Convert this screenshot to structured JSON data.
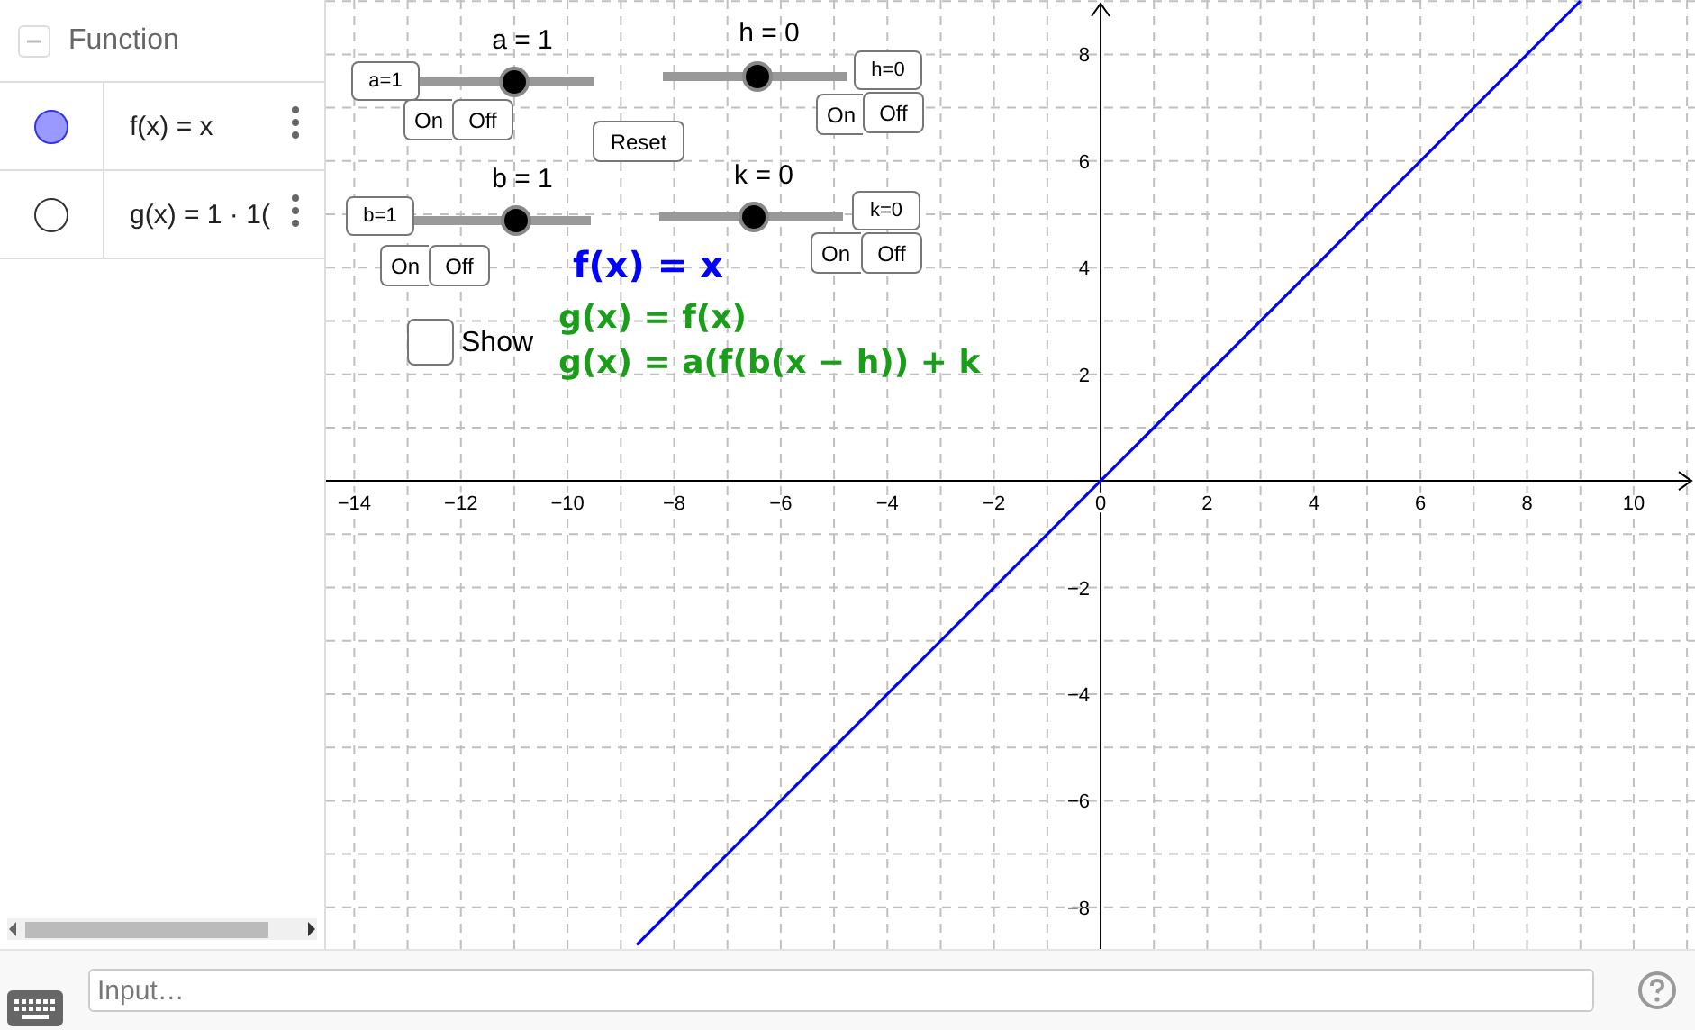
{
  "algebra_view": {
    "header": "Function",
    "expanded": true,
    "items": [
      {
        "expression": "f(x) = x",
        "visible": true,
        "color": "#9999ff"
      },
      {
        "expression": "g(x) = 1 · 1(",
        "visible": false
      }
    ]
  },
  "graphics_view": {
    "sliders": [
      {
        "label": "a = 1",
        "level": 0.55,
        "input_value": "a=1",
        "buttons": [
          "On",
          "Off"
        ]
      },
      {
        "label": "h = 0",
        "level": 0.51,
        "input_value": "h=0",
        "buttons": [
          "On",
          "Off"
        ]
      },
      {
        "label": "b = 1",
        "level": 0.58,
        "input_value": "b=1",
        "buttons": [
          "On",
          "Off"
        ]
      },
      {
        "label": "k = 0",
        "level": 0.51,
        "input_value": "k=0",
        "buttons": [
          "On",
          "Off"
        ]
      }
    ],
    "reset_button": "Reset",
    "checkbox": {
      "label": "Show",
      "checked": false
    },
    "texts": [
      {
        "text": "f(x) = x",
        "color": "#0000ff"
      },
      {
        "text": "g(x) = f(x)",
        "color": "#1a9e1a"
      },
      {
        "text": "g(x) = a(f(b(x − h)) + k",
        "color": "#1a9e1a"
      }
    ],
    "chart_data": {
      "type": "line",
      "x": [
        -8.7,
        9
      ],
      "series": [
        {
          "color": "#0000ff",
          "values": [
            -8.7,
            9
          ]
        }
      ],
      "grid": true,
      "xlim": [
        -14.53,
        11.15
      ],
      "ylim": [
        -8.78,
        9.02
      ],
      "xticks": [
        {
          "value": -14,
          "label": "−14"
        },
        {
          "value": -12,
          "label": "−12"
        },
        {
          "value": -10,
          "label": "−10"
        },
        {
          "value": -8,
          "label": "−8"
        },
        {
          "value": -6,
          "label": "−6"
        },
        {
          "value": -4,
          "label": "−4"
        },
        {
          "value": -2,
          "label": "−2"
        },
        {
          "value": 0,
          "label": "0"
        },
        {
          "value": 2,
          "label": "2"
        },
        {
          "value": 4,
          "label": "4"
        },
        {
          "value": 6,
          "label": "6"
        },
        {
          "value": 8,
          "label": "8"
        },
        {
          "value": 10,
          "label": "10"
        }
      ],
      "yticks": [
        {
          "value": -8,
          "label": "−8"
        },
        {
          "value": -6,
          "label": "−6"
        },
        {
          "value": -4,
          "label": "−4"
        },
        {
          "value": -2,
          "label": "−2"
        },
        {
          "value": 2,
          "label": "2"
        },
        {
          "value": 4,
          "label": "4"
        },
        {
          "value": 6,
          "label": "6"
        },
        {
          "value": 8,
          "label": "8"
        }
      ]
    }
  },
  "input_bar": {
    "placeholder": "Input…"
  }
}
